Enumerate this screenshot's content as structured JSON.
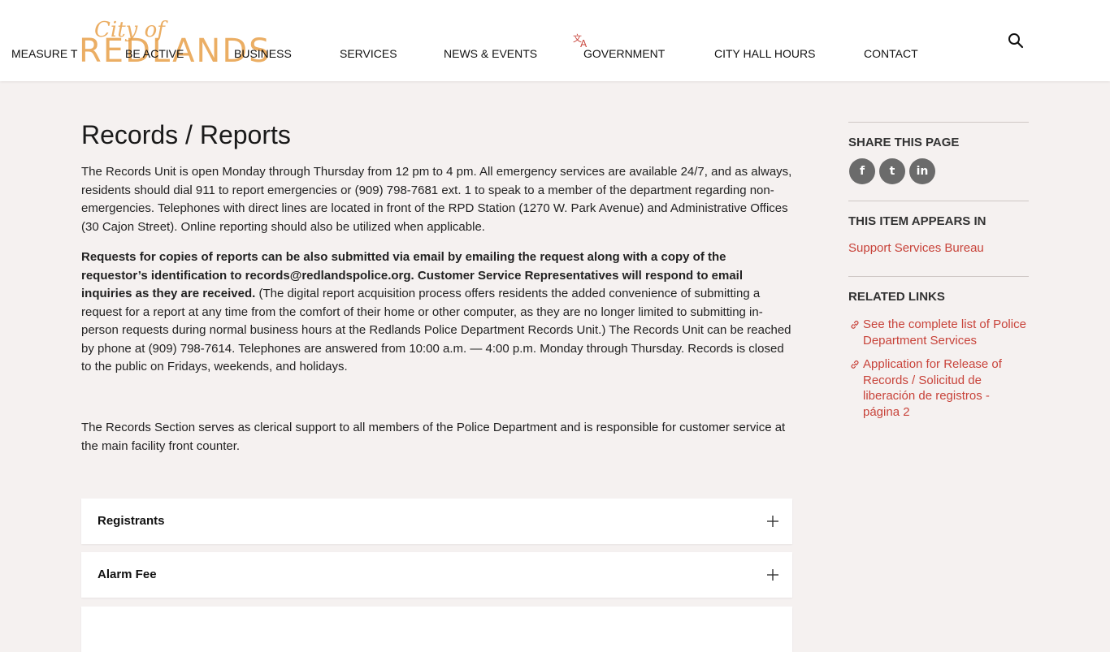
{
  "header": {
    "logo_small": "City of",
    "logo_main": "REDLANDS",
    "nav": [
      {
        "label": "MEASURE T"
      },
      {
        "label": "BE ACTIVE"
      },
      {
        "label": "BUSINESS"
      },
      {
        "label": "SERVICES"
      },
      {
        "label": "NEWS & EVENTS"
      },
      {
        "label": "GOVERNMENT"
      },
      {
        "label": "CITY HALL HOURS"
      },
      {
        "label": "CONTACT"
      }
    ],
    "icons": {
      "translate": "translate-icon",
      "search": "search-icon"
    }
  },
  "main": {
    "title": "Records / Reports",
    "p1": "The Records Unit is open Monday through Thursday from 12 pm to 4 pm.  All emergency services are  available 24/7, and as always, residents should dial 911 to report emergencies or (909) 798-7681 ext. 1 to speak to a member of the department regarding non-emergencies.  Telephones with direct lines are located in front of the RPD Station (1270 W. Park Avenue) and Administrative Offices (30 Cajon Street).  Online reporting should also be utilized when applicable.",
    "p2_bold": "Requests for copies of reports can be also submitted via email by emailing the request along with a copy of the requestor’s identification to records@redlandspolice.org.  Customer Service Representatives will respond to email inquiries as they are received.",
    "p2_rest": "   (The digital report acquisition process offers residents the added convenience of submitting a request for a report at any time from the comfort of their home or other computer, as they are no longer limited to submitting in-person requests during normal business hours at the Redlands Police Department Records Unit.)    The Records Unit can be reached by phone at (909) 798-7614.  Telephones are answered from 10:00 a.m. — 4:00 p.m. Monday through Thursday.  Records is closed to the public on Fridays, weekends, and holidays.",
    "p3": "The Records Section serves as clerical support to all members of the Police Department and is responsible for customer service at the main facility front counter.",
    "accordions": [
      {
        "label": "Registrants"
      },
      {
        "label": "Alarm Fee"
      },
      {
        "label": ""
      }
    ]
  },
  "sidebar": {
    "share_heading": "SHARE THIS PAGE",
    "social": {
      "facebook": "f",
      "twitter": "t",
      "linkedin": "in"
    },
    "appears_heading": "THIS ITEM APPEARS IN",
    "appears_link": "Support Services Bureau",
    "related_heading": "RELATED LINKS",
    "related_links": [
      {
        "label": "See the complete list of Police Department Services"
      },
      {
        "label": "Application for Release of Records / Solicitud de liberación de registros - página 2"
      }
    ]
  },
  "colors": {
    "accent_link": "#c8433a",
    "logo_orange": "#e8a04a",
    "page_bg": "#f5f1f0",
    "social_bg": "#6b6b6b"
  }
}
